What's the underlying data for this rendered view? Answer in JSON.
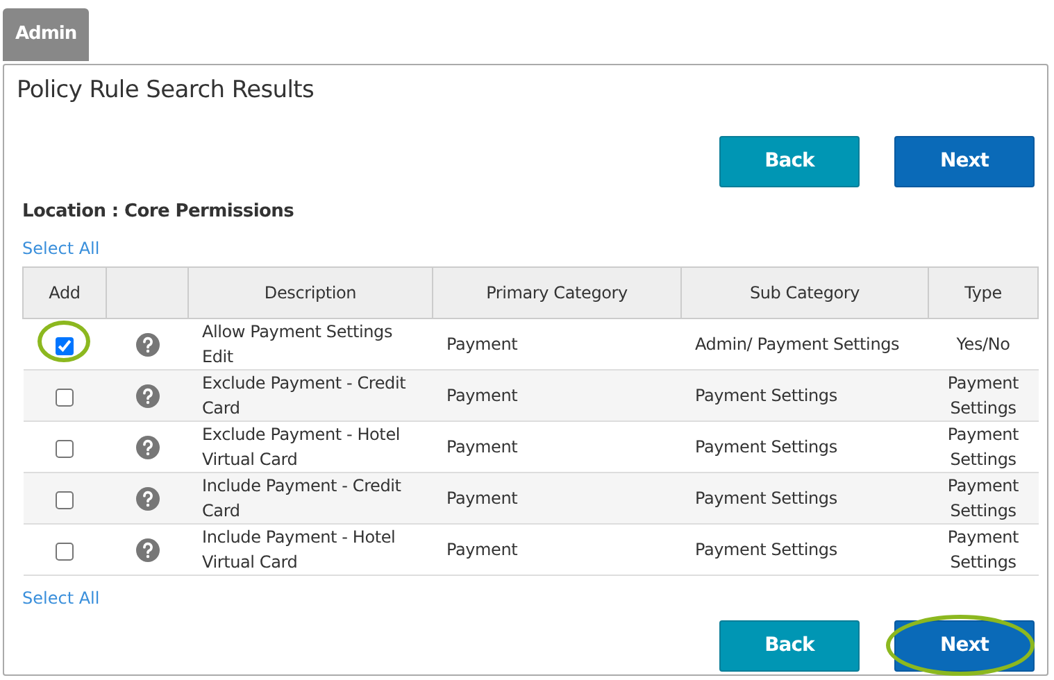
{
  "tab": {
    "label": "Admin"
  },
  "title": "Policy Rule Search Results",
  "top_buttons": [
    {
      "label": "Back",
      "kind": "back",
      "highlighted": false
    },
    {
      "label": "Next",
      "kind": "next",
      "highlighted": false
    }
  ],
  "location": "Location : Core Permissions",
  "select_all_top": "Select All",
  "table": {
    "columns": [
      "Add",
      "Description",
      "Primary Category",
      "Sub Category",
      "Type"
    ],
    "rows": [
      {
        "checked": true,
        "highlighted": true,
        "description": "Allow Payment Settings Edit",
        "primary_category": "Payment",
        "sub_category": "Admin/ Payment Settings",
        "type": "Yes/No"
      },
      {
        "checked": false,
        "highlighted": false,
        "description": "Exclude Payment - Credit Card",
        "primary_category": "Payment",
        "sub_category": "Payment Settings",
        "type": "Payment Settings"
      },
      {
        "checked": false,
        "highlighted": false,
        "description": "Exclude Payment - Hotel Virtual Card",
        "primary_category": "Payment",
        "sub_category": "Payment Settings",
        "type": "Payment Settings"
      },
      {
        "checked": false,
        "highlighted": false,
        "description": "Include Payment - Credit Card",
        "primary_category": "Payment",
        "sub_category": "Payment Settings",
        "type": "Payment Settings"
      },
      {
        "checked": false,
        "highlighted": false,
        "description": "Include Payment - Hotel Virtual Card",
        "primary_category": "Payment",
        "sub_category": "Payment Settings",
        "type": "Payment Settings"
      }
    ]
  },
  "select_all_bottom": "Select All",
  "bottom_buttons": [
    {
      "label": "Back",
      "kind": "back",
      "highlighted": false
    },
    {
      "label": "Next",
      "kind": "next",
      "highlighted": true
    }
  ]
}
